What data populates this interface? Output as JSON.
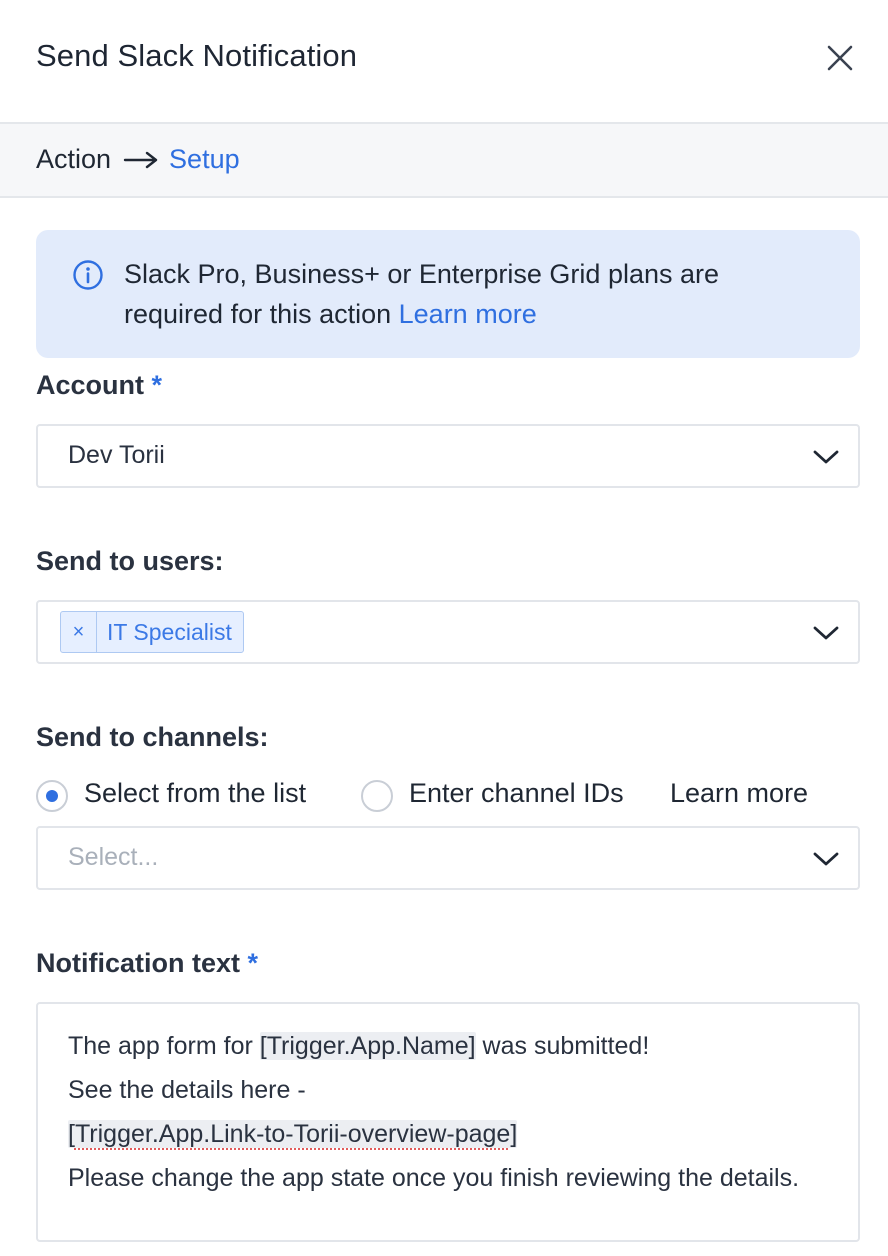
{
  "header": {
    "title": "Send Slack Notification"
  },
  "breadcrumb": {
    "action": "Action",
    "setup": "Setup"
  },
  "info": {
    "text": "Slack Pro, Business+ or Enterprise Grid plans are required for this action ",
    "link": "Learn more"
  },
  "account": {
    "label": "Account",
    "required": "*",
    "value": "Dev Torii"
  },
  "users": {
    "label": "Send to users:",
    "tags": [
      "IT Specialist"
    ],
    "tag_remove": "×"
  },
  "channels": {
    "label": "Send to channels:",
    "option_list": "Select from the list",
    "option_ids": "Enter channel IDs",
    "learn_more": "Learn more",
    "selected_option": "Select from the list",
    "placeholder": "Select..."
  },
  "notification": {
    "label": "Notification text",
    "required": "*",
    "line1_prefix": "The app form for ",
    "line1_var": "[Trigger.App.Name]",
    "line1_suffix": " was submitted!",
    "line2": "See the details here -",
    "line3_var_open": "[",
    "line3_var_body": "Trigger.App.Link-to-Torii-overview-page",
    "line3_var_close": "]",
    "line4": "Please change the app state once you finish reviewing the details."
  },
  "colors": {
    "accent": "#2f6fe0",
    "info_bg": "#e2ebfb",
    "tag_bg": "#e6efff"
  }
}
